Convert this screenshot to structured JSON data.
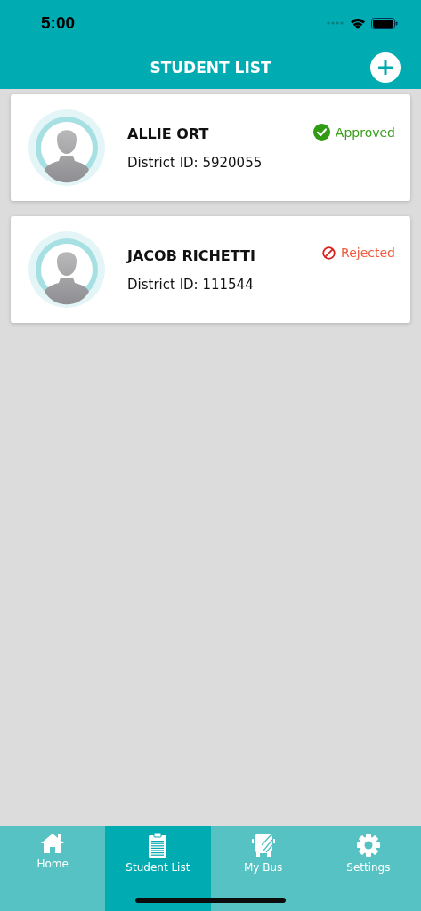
{
  "status_bar": {
    "time": "5:00"
  },
  "header": {
    "title": "STUDENT LIST"
  },
  "students": [
    {
      "name": "ALLIE ORT",
      "district_id": "District ID: 5920055",
      "status": {
        "kind": "approved",
        "label": "Approved"
      }
    },
    {
      "name": "JACOB RICHETTI",
      "district_id": "District ID: 111544",
      "status": {
        "kind": "rejected",
        "label": "Rejected"
      }
    }
  ],
  "tabs": [
    {
      "kind": "home",
      "label": "Home",
      "selected": false
    },
    {
      "kind": "list",
      "label": "Student List",
      "selected": true
    },
    {
      "kind": "bus",
      "label": "My Bus",
      "selected": false
    },
    {
      "kind": "settings",
      "label": "Settings",
      "selected": false
    }
  ]
}
